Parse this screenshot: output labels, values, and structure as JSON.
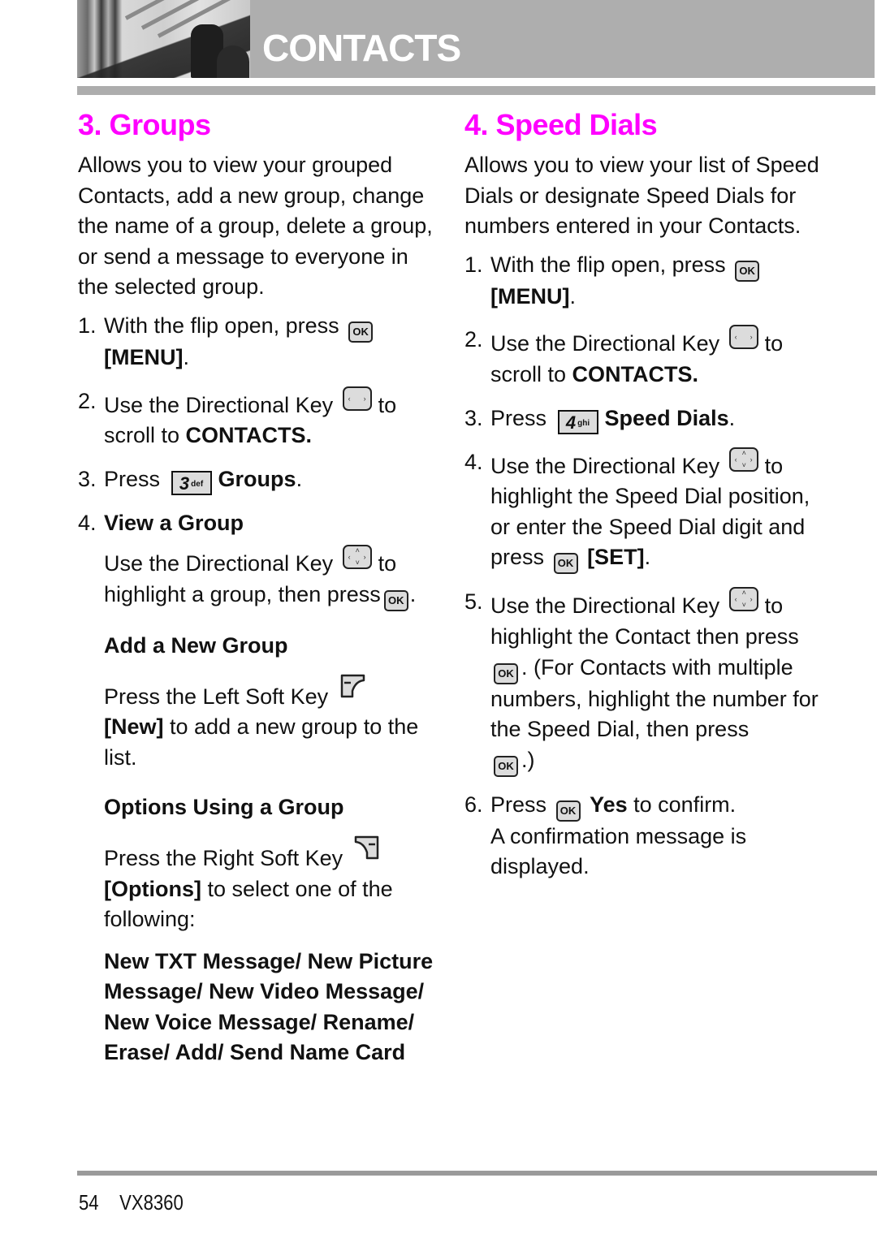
{
  "header": {
    "title": "CONTACTS",
    "photo": "person-on-staircase-photo"
  },
  "groups": {
    "heading": "3. Groups",
    "intro": "Allows you to view your grouped Contacts, add a new group, change the name of a group, delete a group, or send a message to everyone in the selected group.",
    "step1": {
      "num": "1.",
      "text": "With the flip open, press",
      "key": "OK",
      "bold": "[MENU]",
      "end": "."
    },
    "step2": {
      "num": "2.",
      "text": "Use the Directional Key",
      "to": "to",
      "text2": "scroll to",
      "bold": "CONTACTS."
    },
    "step3": {
      "num": "3.",
      "text": "Press",
      "key_num": "3",
      "key_sub": "def",
      "bold": "Groups",
      "end": "."
    },
    "step4": {
      "num": "4.",
      "bold": "View a Group"
    },
    "view_text": {
      "text": "Use the Directional Key",
      "to": "to",
      "text2": "highlight a group, then press",
      "key": "OK",
      "end": "."
    },
    "add_head": "Add a New Group",
    "add_text": {
      "text": "Press the Left Soft Key",
      "bold": "[New]",
      "text2": "to add a new group to the list."
    },
    "options_head": "Options Using a Group",
    "options_text": {
      "text": "Press the Right Soft Key",
      "bold": "[Options]",
      "text2": "to select one of the following:"
    },
    "options_list": "New TXT Message/ New Picture Message/ New Video Message/  New Voice Message/ Rename/ Erase/ Add/ Send Name Card"
  },
  "speed_dials": {
    "heading": "4. Speed Dials",
    "intro": "Allows you to view your list of Speed Dials or designate Speed Dials for numbers entered in your Contacts.",
    "step1": {
      "num": "1.",
      "text": "With the flip open, press",
      "key": "OK",
      "bold": "[MENU]",
      "end": "."
    },
    "step2": {
      "num": "2.",
      "text": "Use the Directional Key",
      "to": "to",
      "text2": "scroll to",
      "bold": "CONTACTS."
    },
    "step3": {
      "num": "3.",
      "text": "Press",
      "key_num": "4",
      "key_sub": "ghi",
      "bold": "Speed Dials",
      "end": "."
    },
    "step4": {
      "num": "4.",
      "text": "Use the Directional Key",
      "to": "to",
      "text2": "highlight the Speed Dial position, or enter the Speed Dial digit and press",
      "key": "OK",
      "bold": "[SET]",
      "end": "."
    },
    "step5": {
      "num": "5.",
      "text": "Use the Directional Key",
      "to": "to",
      "text2": "highlight the Contact then press",
      "key": "OK",
      "text3": ". (For Contacts with multiple numbers, highlight the number for the Speed Dial, then press",
      "end": ".)"
    },
    "step6": {
      "num": "6.",
      "text": "Press",
      "key": "OK",
      "bold": "Yes",
      "text2": "to confirm.",
      "text3": "A confirmation message is displayed."
    }
  },
  "footer": {
    "page_number": "54",
    "model": "VX8360"
  },
  "colors": {
    "heading": "#ff00ff",
    "header_band": "#aeaeae",
    "rule": "#adadad"
  }
}
